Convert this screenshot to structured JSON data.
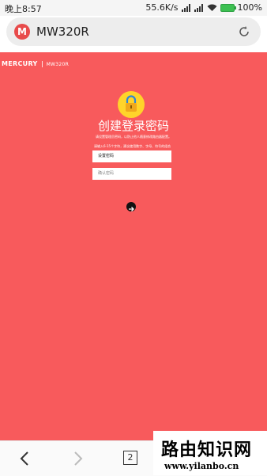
{
  "status": {
    "time": "晚上8:57",
    "speed": "55.6K/s",
    "battery": "100%"
  },
  "browser": {
    "site_icon_letter": "M",
    "url": "MW320R",
    "tabs_count": "2"
  },
  "page": {
    "brand": "MERCURY",
    "model": "MW320R",
    "title": "创建登录密码",
    "subtitle": "请设置管理员密码，以防止他人随意修改路由器配置。",
    "hint": "请输入6-15个字符，建议使用数字、字母、符号的组合",
    "password_placeholder": "设置密码",
    "confirm_placeholder": "确认密码",
    "accent_color": "#f85a5c",
    "lock_color": "#ffd42a"
  },
  "watermark": {
    "line1": "路由知识网",
    "line2": "www.yilanbo.cn"
  }
}
